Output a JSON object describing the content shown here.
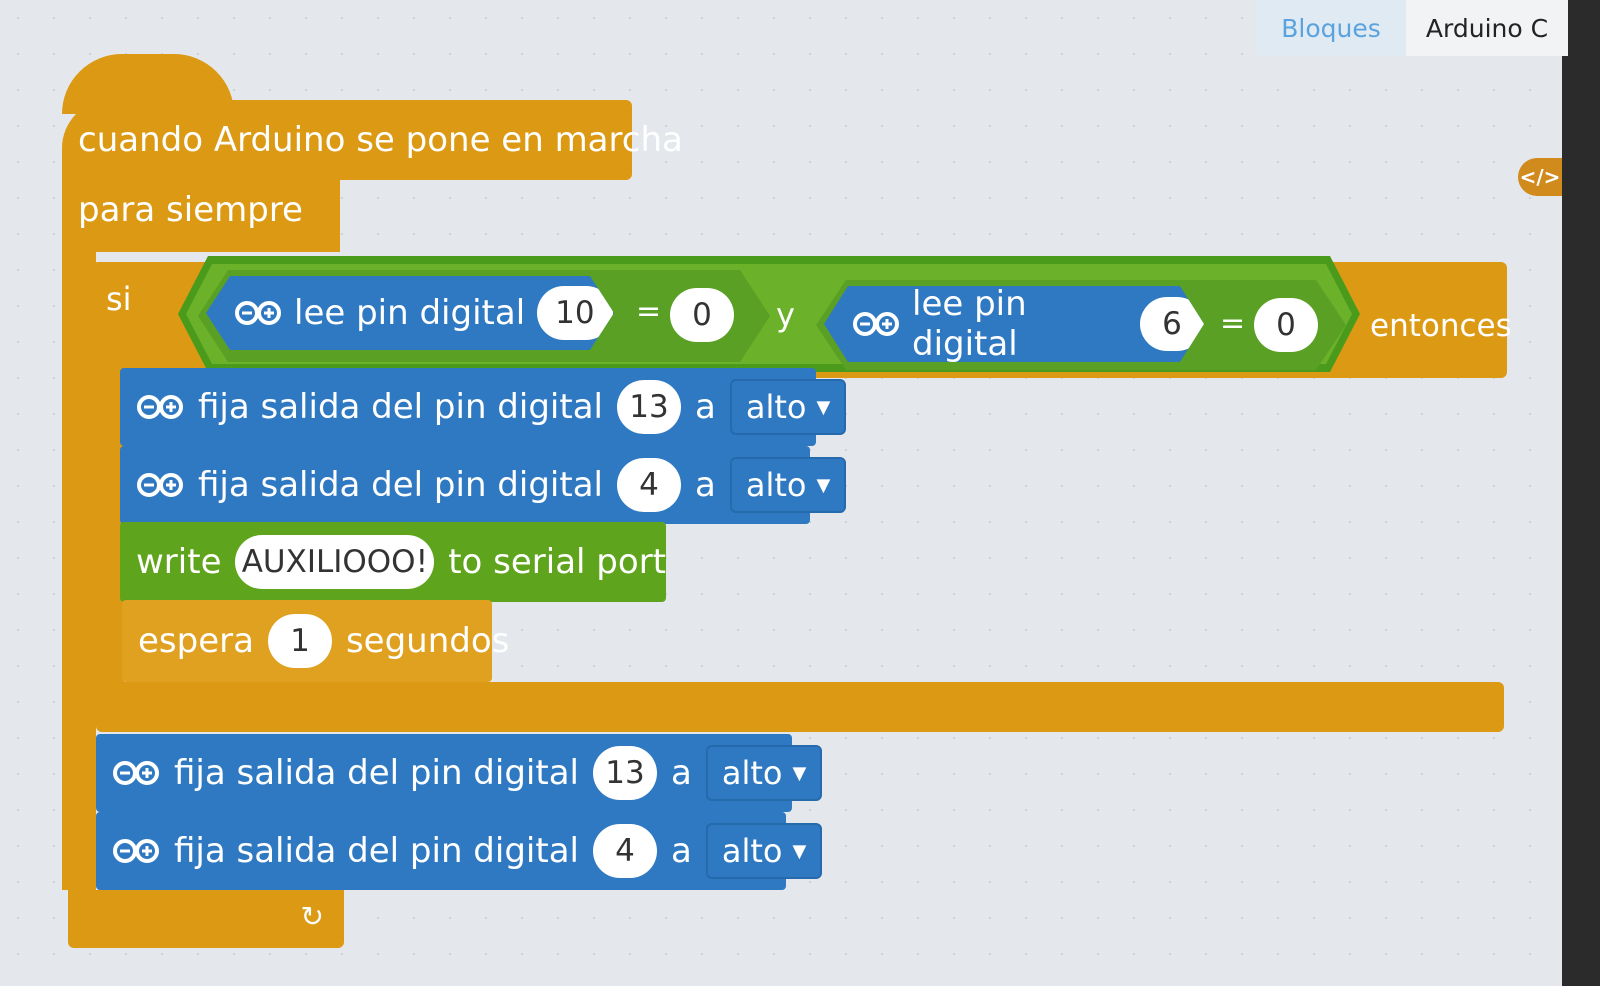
{
  "tabs": [
    {
      "label": "Bloques"
    },
    {
      "label": "Arduino C"
    }
  ],
  "code_toggle": "</>",
  "hat": {
    "label": "cuando Arduino se pone en marcha"
  },
  "forever": {
    "label": "para siempre"
  },
  "if_block": {
    "label": "si",
    "then_label": "entonces",
    "and_label": "y",
    "cond1": {
      "read_label": "lee pin digital",
      "pin": "10",
      "op": "=",
      "value": "0"
    },
    "cond2": {
      "read_label": "lee pin digital",
      "pin": "6",
      "op": "=",
      "value": "0"
    }
  },
  "inner": {
    "set1": {
      "label": "fija salida del pin digital",
      "pin": "13",
      "a": "a",
      "level": "alto"
    },
    "set2": {
      "label": "fija salida del pin digital",
      "pin": "4",
      "a": "a",
      "level": "alto"
    },
    "write": {
      "label": "write",
      "text": "AUXILIOOO!",
      "suffix": "to serial port"
    },
    "wait": {
      "label": "espera",
      "value": "1",
      "unit": "segundos"
    }
  },
  "after": {
    "set1": {
      "label": "fija salida del pin digital",
      "pin": "13",
      "a": "a",
      "level": "alto"
    },
    "set2": {
      "label": "fija salida del pin digital",
      "pin": "4",
      "a": "a",
      "level": "alto"
    }
  },
  "colors": {
    "control": "#db9914",
    "arduino": "#2f79c2",
    "operator": "#5ea51d",
    "tab_active": "#5aa3de"
  }
}
